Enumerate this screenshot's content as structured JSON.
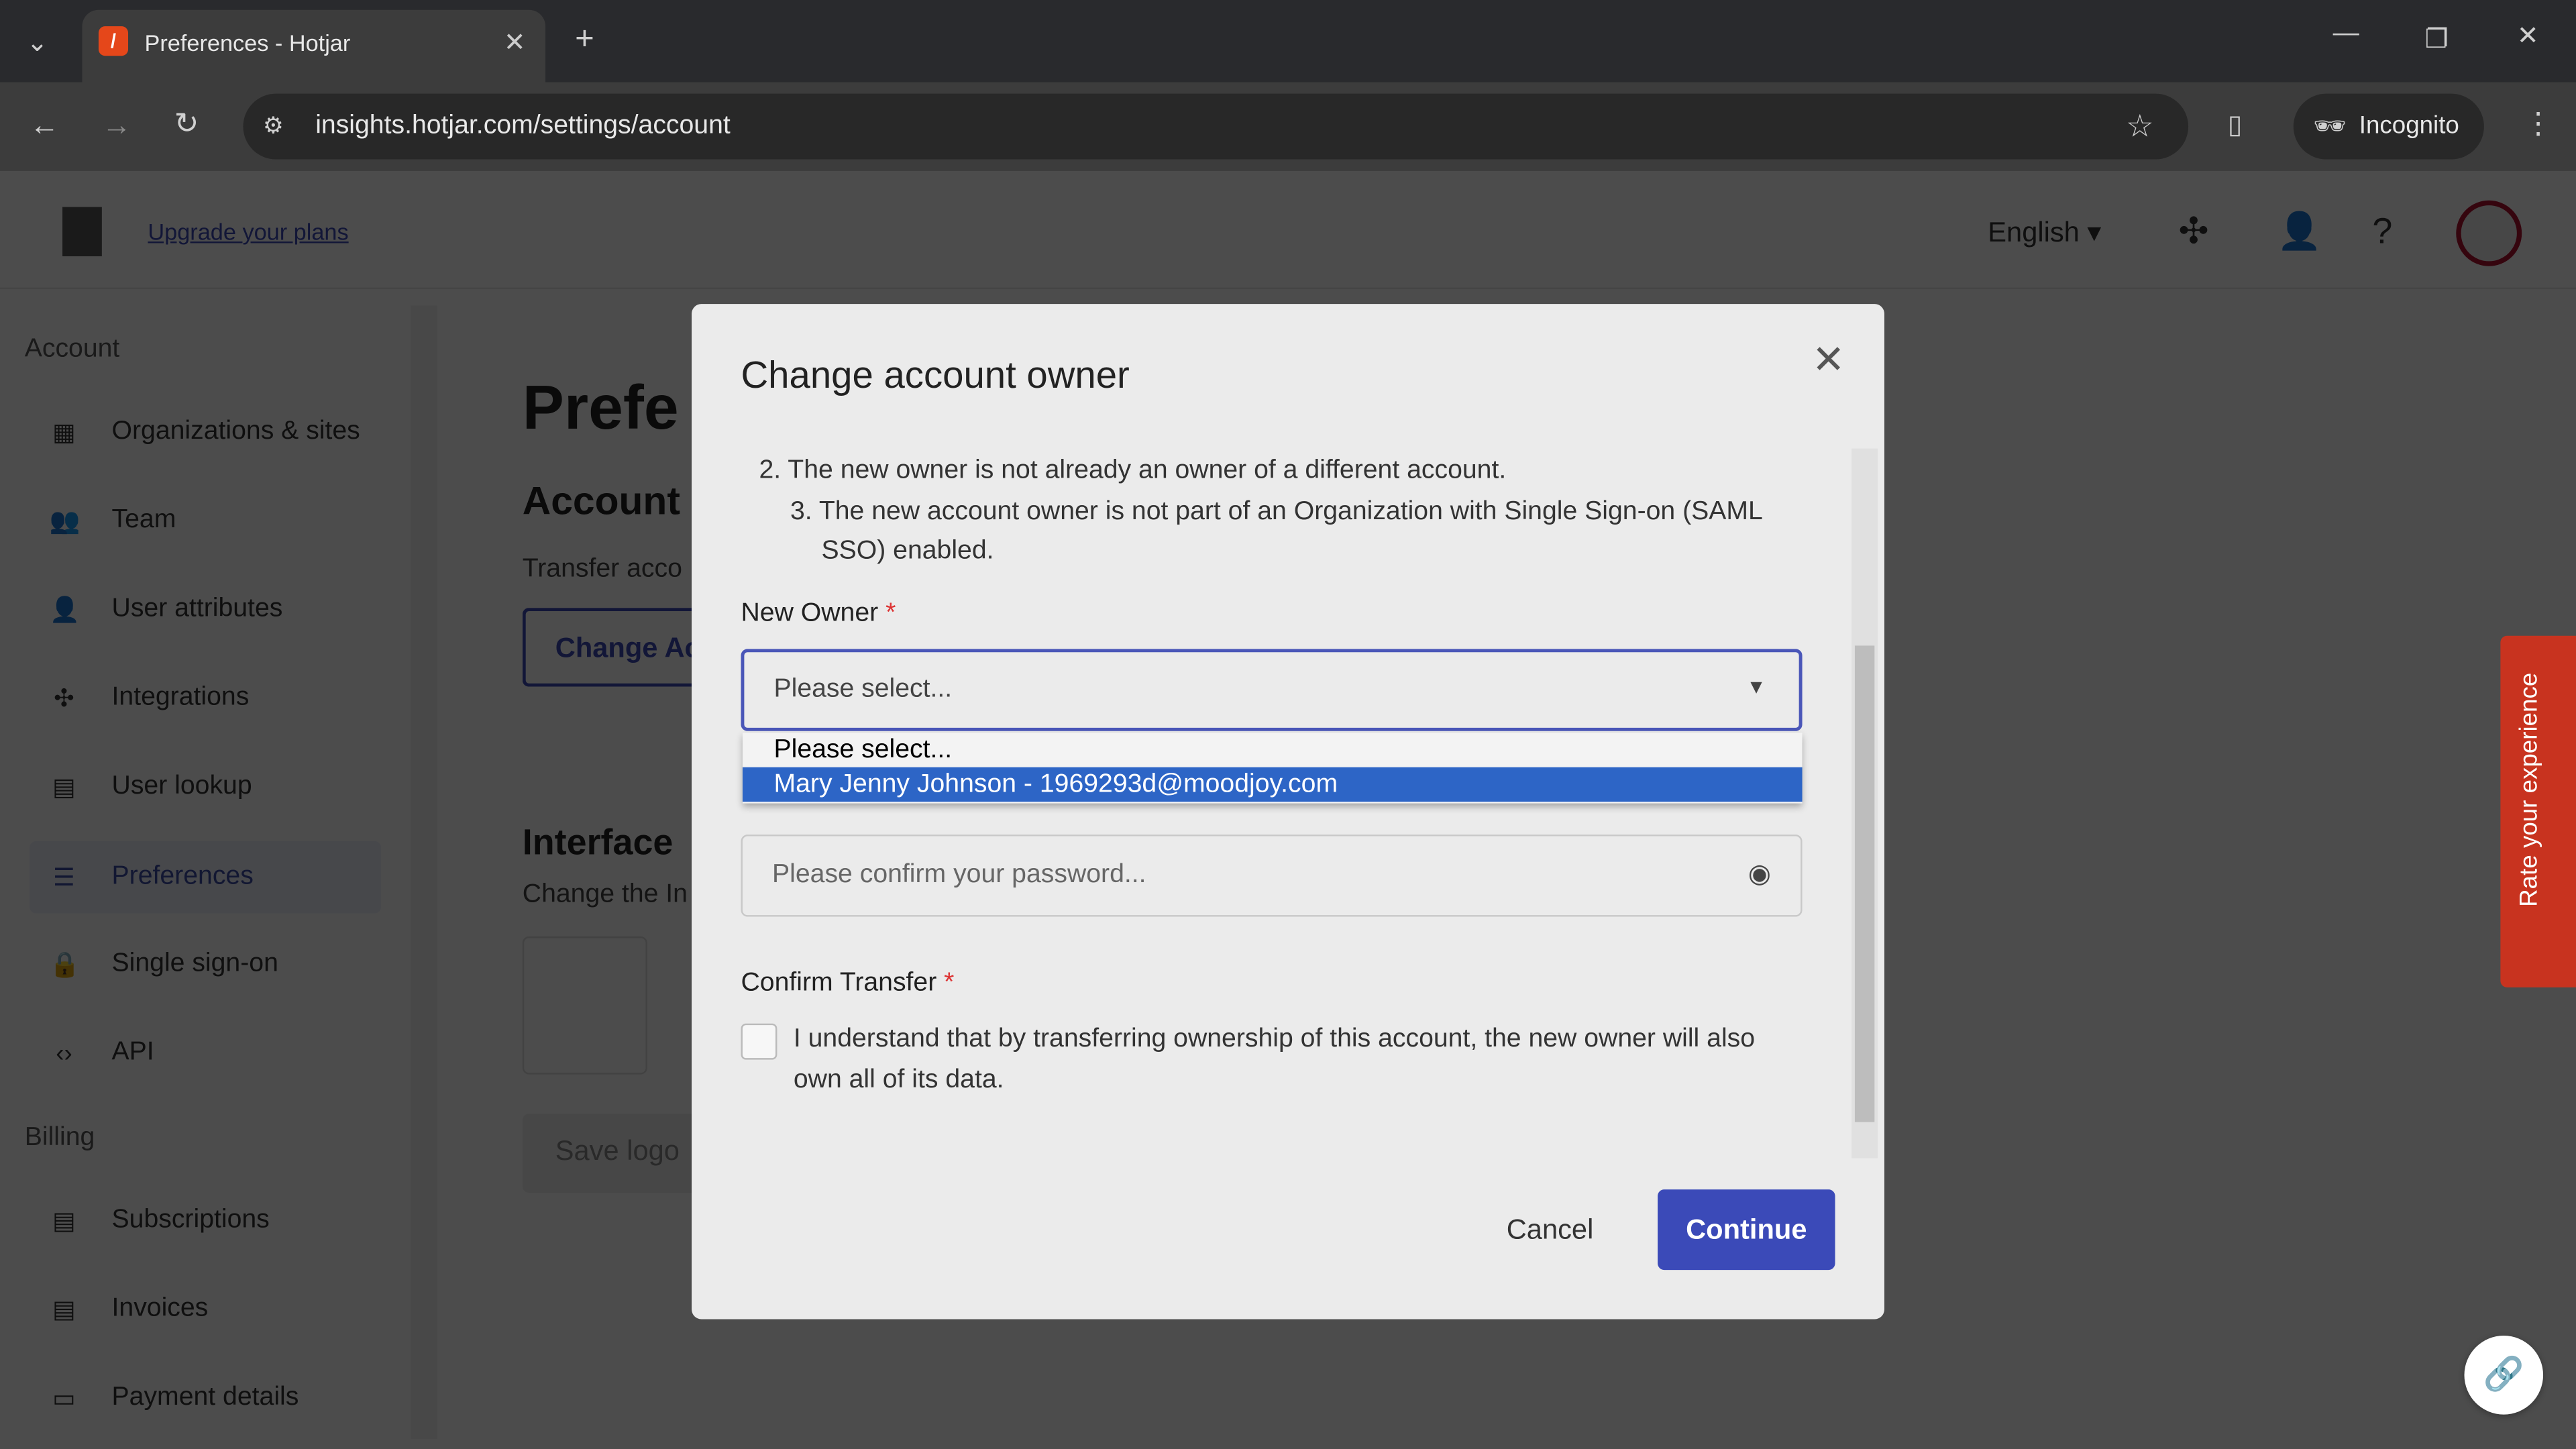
{
  "browser": {
    "tab_title": "Preferences - Hotjar",
    "url": "insights.hotjar.com/settings/account",
    "incognito_label": "Incognito"
  },
  "header": {
    "upgrade_link": "Upgrade your plans",
    "language": "English"
  },
  "sidebar": {
    "account_section": "Account",
    "billing_section": "Billing",
    "items": [
      {
        "label": "Organizations & sites"
      },
      {
        "label": "Team"
      },
      {
        "label": "User attributes"
      },
      {
        "label": "Integrations"
      },
      {
        "label": "User lookup"
      },
      {
        "label": "Preferences"
      },
      {
        "label": "Single sign-on"
      },
      {
        "label": "API"
      }
    ],
    "billing_items": [
      {
        "label": "Subscriptions"
      },
      {
        "label": "Invoices"
      },
      {
        "label": "Payment details"
      }
    ]
  },
  "main": {
    "title": "Prefe",
    "subtitle": "Account",
    "transfer_text": "Transfer acco",
    "change_button": "Change Ac",
    "interface_title": "Interface",
    "interface_text": "Change the In",
    "save_logo": "Save logo"
  },
  "modal": {
    "title": "Change account owner",
    "conditions": [
      "2. The new owner is not already an owner of a different account.",
      "3. The new account owner is not part of an Organization with Single Sign-on (SAML SSO) enabled."
    ],
    "new_owner_label": "New Owner",
    "required_mark": "*",
    "select_value": "Please select...",
    "options": [
      "Please select...",
      "Mary Jenny Johnson - 1969293d@moodjoy.com"
    ],
    "password_placeholder": "Please confirm your password...",
    "confirm_label": "Confirm Transfer",
    "confirm_text": "I understand that by transferring ownership of this account, the new owner will also own all of its data.",
    "cancel": "Cancel",
    "continue": "Continue"
  },
  "feedback_tab": "Rate your experience",
  "colors": {
    "accent": "#3b4ab8",
    "highlight": "#2d65c6",
    "feedback": "#c8331f"
  }
}
